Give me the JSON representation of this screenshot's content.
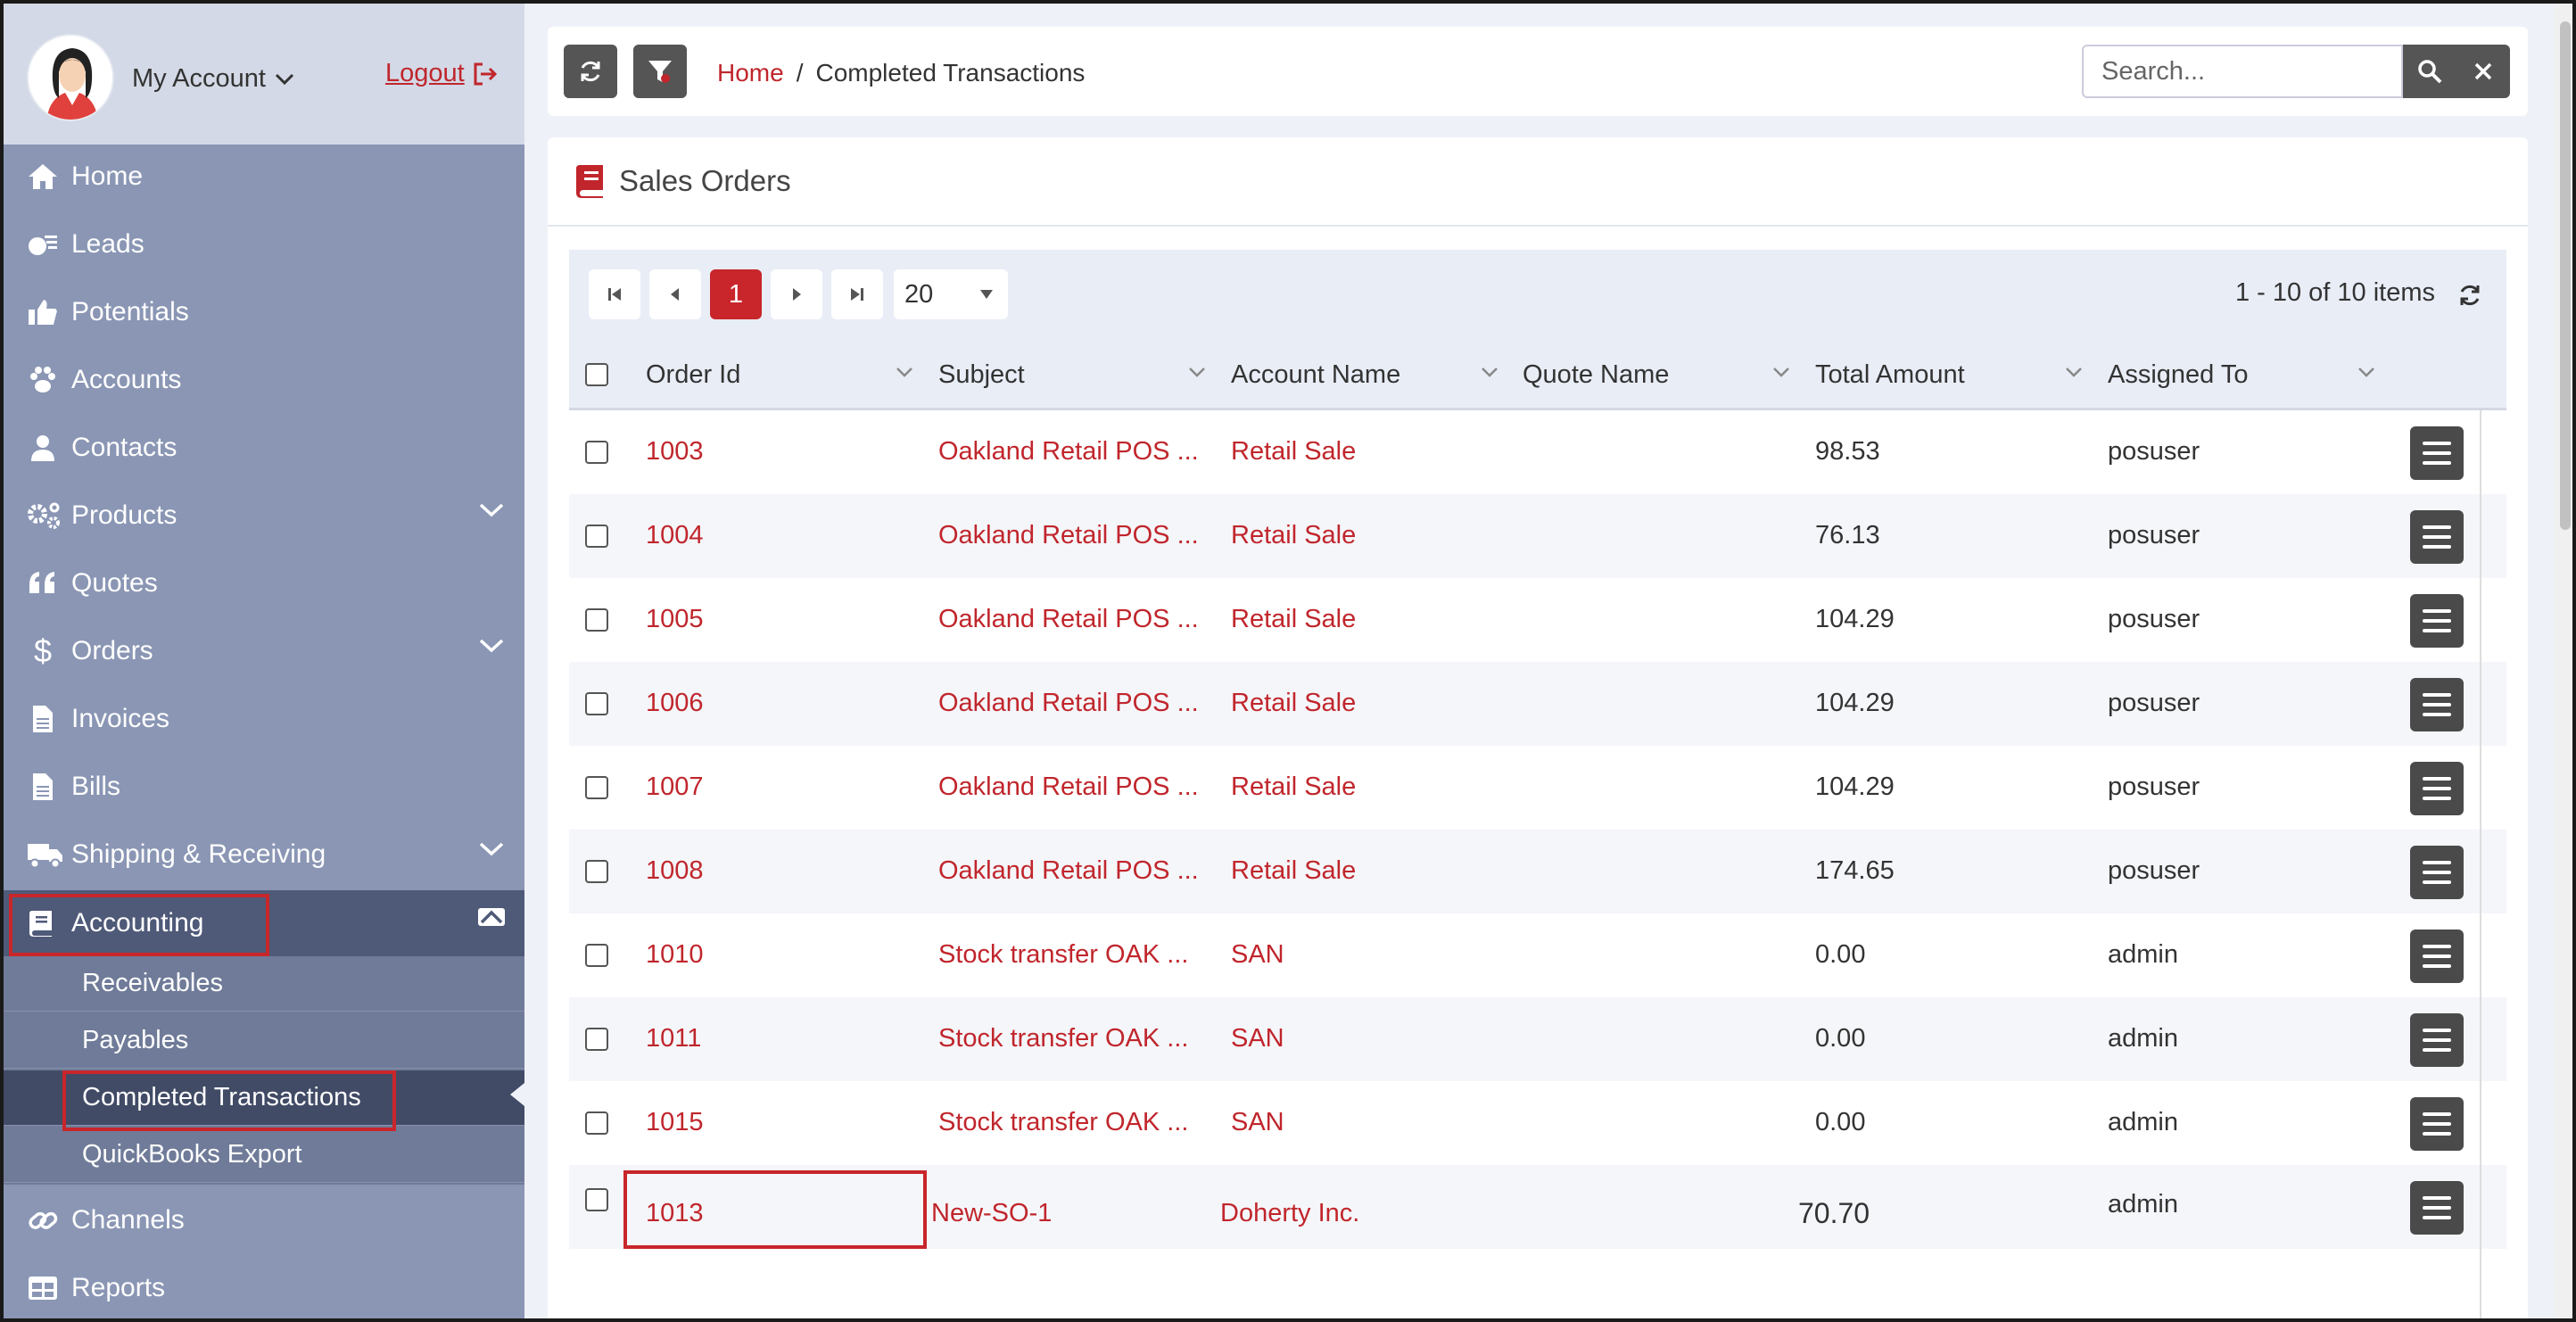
{
  "account": {
    "label": "My Account",
    "logout": "Logout"
  },
  "nav": [
    {
      "label": "Home",
      "icon": "home-icon"
    },
    {
      "label": "Leads",
      "icon": "leads-icon"
    },
    {
      "label": "Potentials",
      "icon": "thumbs-up-icon"
    },
    {
      "label": "Accounts",
      "icon": "paw-icon"
    },
    {
      "label": "Contacts",
      "icon": "user-icon"
    },
    {
      "label": "Products",
      "icon": "gears-icon"
    },
    {
      "label": "Quotes",
      "icon": "quote-icon"
    },
    {
      "label": "Orders",
      "icon": "dollar-icon"
    },
    {
      "label": "Invoices",
      "icon": "file-icon"
    },
    {
      "label": "Bills",
      "icon": "file-icon"
    },
    {
      "label": "Shipping & Receiving",
      "icon": "truck-icon"
    },
    {
      "label": "Accounting",
      "icon": "book-icon"
    },
    {
      "label": "Channels",
      "icon": "link-icon"
    },
    {
      "label": "Reports",
      "icon": "table-icon"
    }
  ],
  "accounting_sub": [
    {
      "label": "Receivables"
    },
    {
      "label": "Payables"
    },
    {
      "label": "Completed Transactions"
    },
    {
      "label": "QuickBooks Export"
    }
  ],
  "breadcrumb": {
    "home": "Home",
    "sep": "/",
    "current": "Completed Transactions"
  },
  "search": {
    "placeholder": "Search..."
  },
  "panel": {
    "title": "Sales Orders"
  },
  "pager": {
    "current": "1",
    "page_size": "20",
    "info": "1 - 10 of 10 items"
  },
  "columns": [
    "Order Id",
    "Subject",
    "Account Name",
    "Quote Name",
    "Total Amount",
    "Assigned To"
  ],
  "rows": [
    {
      "order_id": "1003",
      "subject": "Oakland Retail POS ...",
      "account": "Retail Sale",
      "quote": "",
      "total": "98.53",
      "assigned": "posuser"
    },
    {
      "order_id": "1004",
      "subject": "Oakland Retail POS ...",
      "account": "Retail Sale",
      "quote": "",
      "total": "76.13",
      "assigned": "posuser"
    },
    {
      "order_id": "1005",
      "subject": "Oakland Retail POS ...",
      "account": "Retail Sale",
      "quote": "",
      "total": "104.29",
      "assigned": "posuser"
    },
    {
      "order_id": "1006",
      "subject": "Oakland Retail POS ...",
      "account": "Retail Sale",
      "quote": "",
      "total": "104.29",
      "assigned": "posuser"
    },
    {
      "order_id": "1007",
      "subject": "Oakland Retail POS ...",
      "account": "Retail Sale",
      "quote": "",
      "total": "104.29",
      "assigned": "posuser"
    },
    {
      "order_id": "1008",
      "subject": "Oakland Retail POS ...",
      "account": "Retail Sale",
      "quote": "",
      "total": "174.65",
      "assigned": "posuser"
    },
    {
      "order_id": "1010",
      "subject": "Stock transfer OAK ...",
      "account": "SAN",
      "quote": "",
      "total": "0.00",
      "assigned": "admin"
    },
    {
      "order_id": "1011",
      "subject": "Stock transfer OAK ...",
      "account": "SAN",
      "quote": "",
      "total": "0.00",
      "assigned": "admin"
    },
    {
      "order_id": "1015",
      "subject": "Stock transfer OAK ...",
      "account": "SAN",
      "quote": "",
      "total": "0.00",
      "assigned": "admin"
    },
    {
      "order_id": "1013",
      "subject": "New-SO-1",
      "account": "Doherty Inc.",
      "quote": "",
      "total": "70.70",
      "assigned": "admin"
    }
  ],
  "colors": {
    "accent": "#c0262c",
    "sidebar": "#8a96b4",
    "sidebar_active": "#4f5a78"
  }
}
